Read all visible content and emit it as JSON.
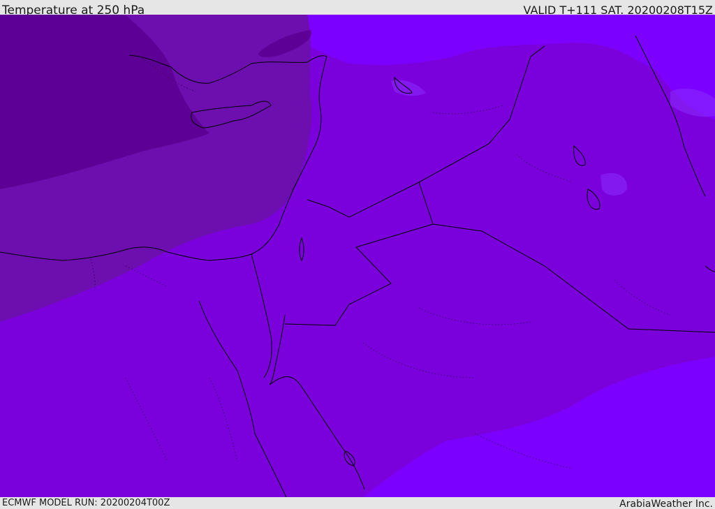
{
  "header": {
    "title": "Temperature at 250 hPa",
    "valid": "VALID T+111 SAT. 20200208T15Z"
  },
  "footer": {
    "model_run": "ECMWF MODEL RUN: 20200204T00Z",
    "credit": "ArabiaWeather Inc."
  },
  "map": {
    "variable": "temperature",
    "pressure_level": "250 hPa",
    "colors": {
      "coldest": "#5d0095",
      "cold": "#6c0fae",
      "mid": "#7a00dc",
      "warm": "#7c00ff",
      "band_light": "#8a2bff",
      "coastline": "#000000"
    }
  }
}
